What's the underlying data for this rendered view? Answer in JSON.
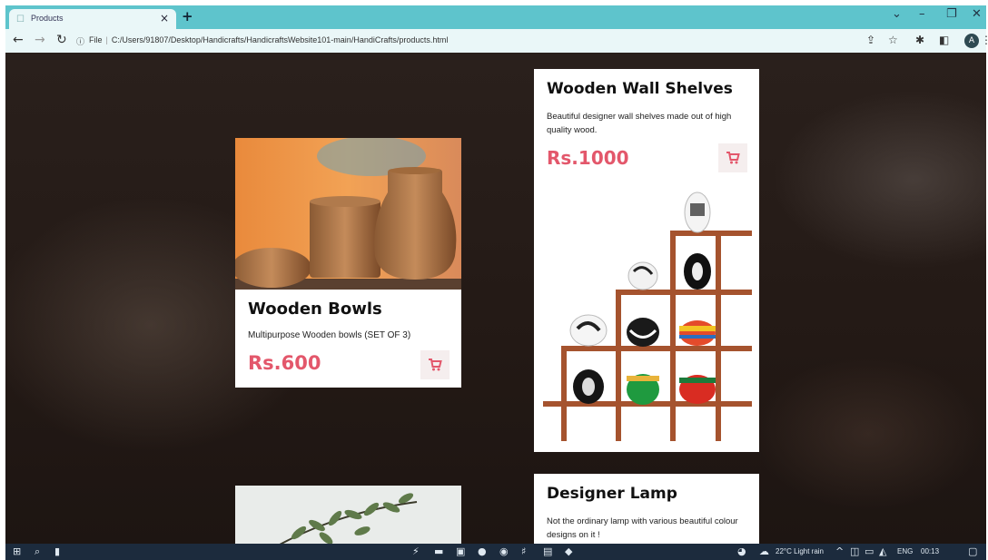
{
  "browser": {
    "tab_title": "Products",
    "tab_close": "×",
    "new_tab": "+",
    "url_scheme": "File",
    "url_path": "C:/Users/91807/Desktop/Handicrafts/HandicraftsWebsite101-main/HandiCrafts/products.html"
  },
  "products": [
    {
      "name": "Wooden Bowls",
      "description": "Multipurpose Wooden bowls (SET OF 3)",
      "price": "Rs.600"
    },
    {
      "name": "Wooden Wall Shelves",
      "description": "Beautiful designer wall shelves made out of high quality wood.",
      "price": "Rs.1000"
    },
    {
      "name": "Designer Lamp",
      "description": "Not the ordinary lamp with various beautiful colour designs on it !"
    }
  ],
  "taskbar": {
    "weather": "22°C Light rain",
    "language": "ENG",
    "time": "00:13"
  },
  "colors": {
    "accent": "#e3576b",
    "chrome": "#5ec4cc",
    "page_background": "#231915"
  }
}
